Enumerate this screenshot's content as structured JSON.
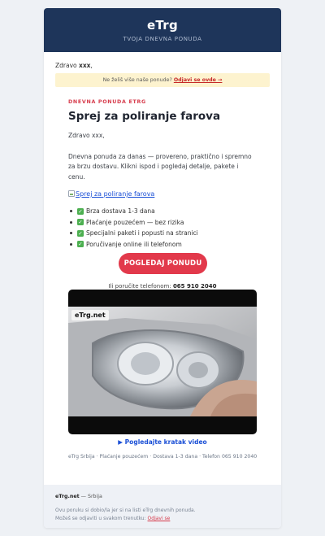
{
  "header": {
    "brand": "eTrg",
    "tagline": "TVOJA DNEVNA PONUDA"
  },
  "greeting_top": {
    "prefix": "Zdravo ",
    "name": "xxx",
    "suffix": ","
  },
  "unsubscribe_bar": {
    "text": "Ne želiš više naše ponude?",
    "link": "Odjavi se ovde →"
  },
  "offer": {
    "kicker": "DNEVNA PONUDA ETRG",
    "title": "Sprej za poliranje farova",
    "greeting": "Zdravo xxx,",
    "intro": "Dnevna ponuda za danas — provereno, praktično i spremno za brzu dostavu. Klikni ispod i pogledaj detalje, pakete i cenu.",
    "image_alt": "Sprej za poliranje farova",
    "features": [
      "Brza dostava 1-3 dana",
      "Plaćanje pouzećem — bez rizika",
      "Specijalni paketi i popusti na stranici",
      "Poručivanje online ili telefonom"
    ],
    "cta_label": "POGLEDAJ PONUDU",
    "phone_prefix": "Ili poručite telefonom:",
    "phone_number": "065 910 2040"
  },
  "video": {
    "logo_text": "eTrg.net",
    "caption": "▶ Pogledajte kratak video"
  },
  "meta_line": "eTrg Srbija · Plaćanje pouzećem · Dostava 1-3 dana · Telefon 065 910 2040",
  "footer": {
    "brand": "eTrg.net",
    "country": " — Srbija",
    "note": "Ovu poruku si dobio/la jer si na listi eTrg dnevnih ponuda.",
    "unsub_text": "Možeš se odjaviti u svakom trenutku:",
    "unsub_link": "Odjavi se"
  },
  "colors": {
    "header_bg": "#1e355a",
    "accent": "#e2394b",
    "link": "#1a4fd6",
    "notice_bg": "#fdf3cf"
  }
}
